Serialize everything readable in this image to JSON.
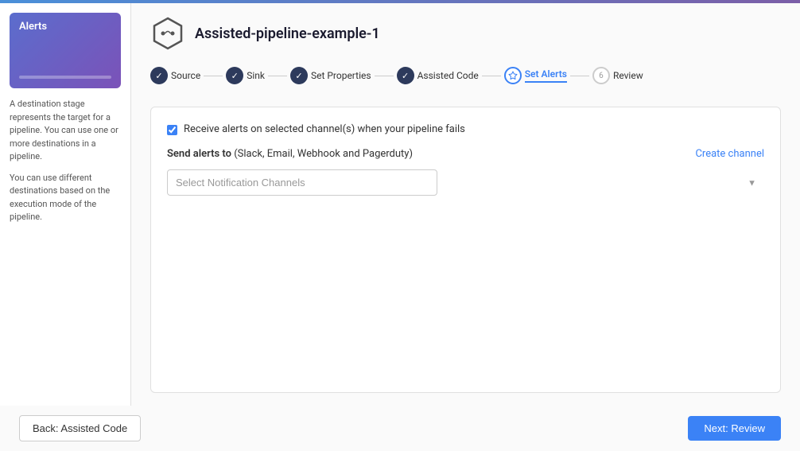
{
  "topbar": {},
  "sidebar": {
    "card_title": "Alerts",
    "description1": "A destination stage represents the target for a pipeline. You can use one or more destinations in a pipeline.",
    "description2": "You can use different destinations based on the execution mode of the pipeline."
  },
  "header": {
    "pipeline_title": "Assisted-pipeline-example-1",
    "icon_label": "pipeline-icon"
  },
  "stepper": {
    "steps": [
      {
        "id": "source",
        "label": "Source",
        "state": "completed"
      },
      {
        "id": "sink",
        "label": "Sink",
        "state": "completed"
      },
      {
        "id": "set-properties",
        "label": "Set Properties",
        "state": "completed"
      },
      {
        "id": "assisted-code",
        "label": "Assisted Code",
        "state": "completed"
      },
      {
        "id": "set-alerts",
        "label": "Set Alerts",
        "state": "active"
      },
      {
        "id": "review",
        "label": "Review",
        "state": "pending",
        "number": "6"
      }
    ]
  },
  "form": {
    "checkbox_checked": true,
    "receive_alerts_text": "Receive alerts on selected channel(s) when your pipeline fails",
    "send_alerts_label": "Send alerts to",
    "send_alerts_sub": "(Slack, Email, Webhook and Pagerduty)",
    "create_channel_label": "Create channel",
    "dropdown_placeholder": "Select Notification Channels"
  },
  "footer": {
    "back_button_label": "Back: Assisted Code",
    "next_button_label": "Next: Review"
  }
}
